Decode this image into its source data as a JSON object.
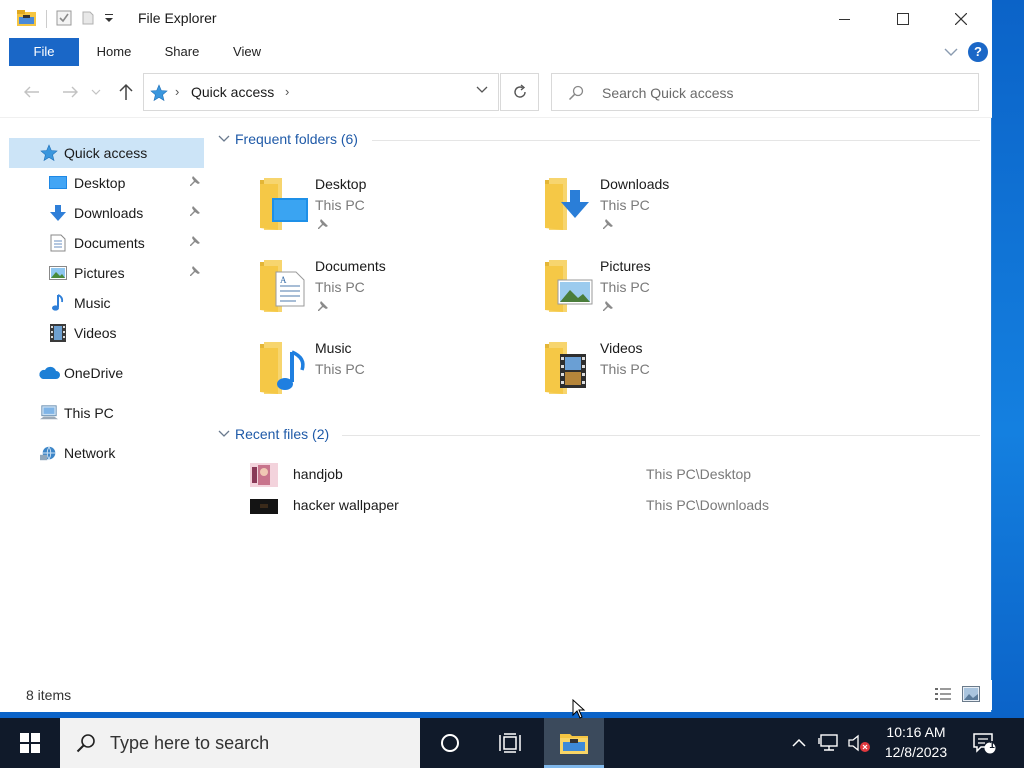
{
  "window": {
    "title": "File Explorer"
  },
  "ribbon": {
    "tabs": [
      "File",
      "Home",
      "Share",
      "View"
    ]
  },
  "address": {
    "location": "Quick access",
    "search_placeholder": "Search Quick access"
  },
  "nav": {
    "items": [
      {
        "label": "Quick access",
        "icon": "star-icon",
        "selected": true
      },
      {
        "label": "Desktop",
        "icon": "desktop-icon",
        "pinned": true
      },
      {
        "label": "Downloads",
        "icon": "download-arrow-icon",
        "pinned": true
      },
      {
        "label": "Documents",
        "icon": "document-icon",
        "pinned": true
      },
      {
        "label": "Pictures",
        "icon": "picture-icon",
        "pinned": true
      },
      {
        "label": "Music",
        "icon": "music-note-icon"
      },
      {
        "label": "Videos",
        "icon": "film-icon"
      },
      {
        "label": "OneDrive",
        "icon": "cloud-icon"
      },
      {
        "label": "This PC",
        "icon": "computer-icon"
      },
      {
        "label": "Network",
        "icon": "network-icon"
      }
    ]
  },
  "frequent": {
    "header": "Frequent folders (6)",
    "folders": [
      {
        "name": "Desktop",
        "location": "This PC",
        "pinned": true
      },
      {
        "name": "Downloads",
        "location": "This PC",
        "pinned": true
      },
      {
        "name": "Documents",
        "location": "This PC",
        "pinned": true
      },
      {
        "name": "Pictures",
        "location": "This PC",
        "pinned": true
      },
      {
        "name": "Music",
        "location": "This PC",
        "pinned": false
      },
      {
        "name": "Videos",
        "location": "This PC",
        "pinned": false
      }
    ]
  },
  "recent": {
    "header": "Recent files (2)",
    "files": [
      {
        "name": "handjob",
        "path": "This PC\\Desktop"
      },
      {
        "name": "hacker wallpaper",
        "path": "This PC\\Downloads"
      }
    ]
  },
  "status": {
    "items": "8 items"
  },
  "taskbar": {
    "search_placeholder": "Type here to search",
    "time": "10:16 AM",
    "date": "12/8/2023",
    "notification_count": "1"
  },
  "colors": {
    "accent": "#1a67c7",
    "selection": "#cce4f7",
    "section_header": "#1f5aa8",
    "folder_yellow": "#f5cb5c",
    "taskbar": "#101a2a"
  }
}
